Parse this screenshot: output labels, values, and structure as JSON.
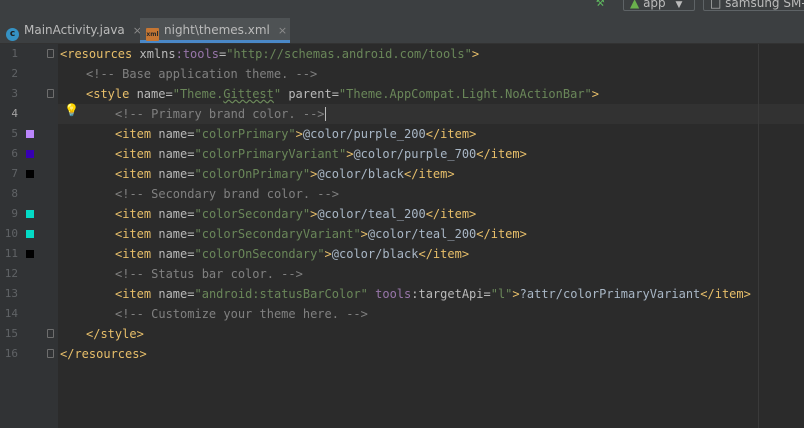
{
  "toolbar": {
    "run_config": "app",
    "device": "samsung SM-"
  },
  "tabs": [
    {
      "label": "MainActivity.java",
      "close": "×"
    },
    {
      "label": "night\\themes.xml",
      "close": "×"
    }
  ],
  "line_numbers": [
    "1",
    "2",
    "3",
    "4",
    "5",
    "6",
    "7",
    "8",
    "9",
    "10",
    "11",
    "12",
    "13",
    "14",
    "15",
    "16"
  ],
  "swatch_colors": {
    "purple_200": "#bb86fc",
    "purple_700": "#3700b3",
    "black": "#000000",
    "teal_200": "#03dac5"
  },
  "code": {
    "l1": {
      "open": "<resources ",
      "attr": "xmlns",
      "ns": ":tools",
      "eq": "=",
      "val": "\"http://schemas.android.com/tools\"",
      "close": ">"
    },
    "l2": {
      "comment": "<!-- Base application theme. -->"
    },
    "l3": {
      "open": "<style ",
      "a1": "name",
      "eq1": "=",
      "v1": "\"Theme.",
      "v1b": "Gittest",
      "v1c": "\"",
      "a2": " parent",
      "eq2": "=",
      "v2": "\"Theme.AppCompat.Light.NoActionBar\"",
      "close": ">"
    },
    "l4": {
      "comment": "<!-- Primary brand color. -->"
    },
    "l5": {
      "open": "<item ",
      "attr": "name",
      "eq": "=",
      "val": "\"colorPrimary\"",
      "gt": ">",
      "text": "@color/purple_200",
      "end": "</item>"
    },
    "l6": {
      "open": "<item ",
      "attr": "name",
      "eq": "=",
      "val": "\"colorPrimaryVariant\"",
      "gt": ">",
      "text": "@color/purple_700",
      "end": "</item>"
    },
    "l7": {
      "open": "<item ",
      "attr": "name",
      "eq": "=",
      "val": "\"colorOnPrimary\"",
      "gt": ">",
      "text": "@color/black",
      "end": "</item>"
    },
    "l8": {
      "comment": "<!-- Secondary brand color. -->"
    },
    "l9": {
      "open": "<item ",
      "attr": "name",
      "eq": "=",
      "val": "\"colorSecondary\"",
      "gt": ">",
      "text": "@color/teal_200",
      "end": "</item>"
    },
    "l10": {
      "open": "<item ",
      "attr": "name",
      "eq": "=",
      "val": "\"colorSecondaryVariant\"",
      "gt": ">",
      "text": "@color/teal_200",
      "end": "</item>"
    },
    "l11": {
      "open": "<item ",
      "attr": "name",
      "eq": "=",
      "val": "\"colorOnSecondary\"",
      "gt": ">",
      "text": "@color/black",
      "end": "</item>"
    },
    "l12": {
      "comment": "<!-- Status bar color. -->"
    },
    "l13": {
      "open": "<item ",
      "attr": "name",
      "eq": "=",
      "val": "\"android:statusBarColor\"",
      "ns": " tools",
      "attr2": ":targetApi",
      "eq2": "=",
      "val2": "\"l\"",
      "gt": ">",
      "text": "?attr/colorPrimaryVariant",
      "end": "</item>"
    },
    "l14": {
      "comment": "<!-- Customize your theme here. -->"
    },
    "l15": {
      "tag": "</style>"
    },
    "l16": {
      "tag": "</resources>"
    }
  }
}
